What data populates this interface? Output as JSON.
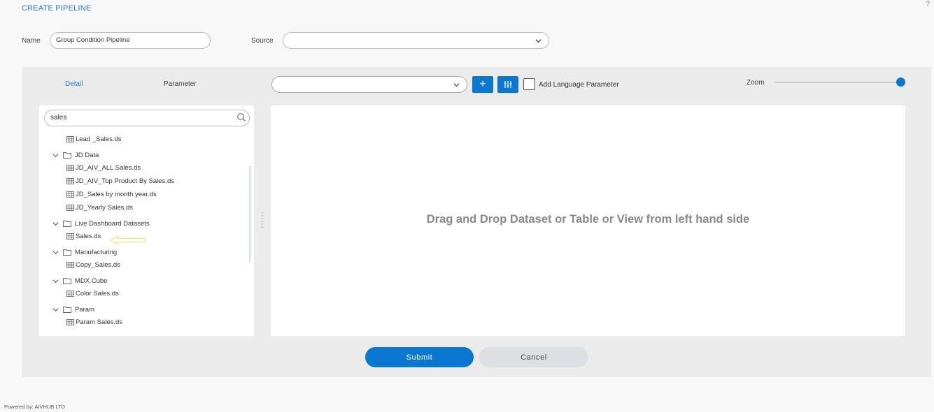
{
  "header": {
    "title": "CREATE PIPELINE",
    "help": "?"
  },
  "form": {
    "name_label": "Name",
    "name_value": "Group Condition Pipeline",
    "source_label": "Source",
    "source_value": ""
  },
  "tabs": {
    "detail": "Detail",
    "parameter": "Parameter"
  },
  "toolbar": {
    "add_label": "+",
    "lang_label": "Add Language Parameter",
    "zoom_label": "Zoom",
    "zoom_level": 1.0
  },
  "tree": {
    "search_value": "sales",
    "items": [
      {
        "type": "file",
        "label": "Lead _Sales.ds"
      },
      {
        "type": "folder",
        "label": "JD Data"
      },
      {
        "type": "file",
        "label": "JD_AIV_ALL Sales.ds"
      },
      {
        "type": "file",
        "label": "JD_AIV_Top Product By Sales.ds"
      },
      {
        "type": "file",
        "label": "JD_Sales by month year.ds"
      },
      {
        "type": "file",
        "label": "JD_Yearly Sales.ds"
      },
      {
        "type": "folder",
        "label": "Live Dashboard Datasets"
      },
      {
        "type": "file",
        "label": "Sales.ds"
      },
      {
        "type": "folder",
        "label": "Manufacturing"
      },
      {
        "type": "file",
        "label": "Copy_Sales.ds"
      },
      {
        "type": "folder",
        "label": "MDX Cube"
      },
      {
        "type": "file",
        "label": "Color Sales.ds"
      },
      {
        "type": "folder",
        "label": "Param"
      },
      {
        "type": "file",
        "label": "Param Sales.ds"
      }
    ]
  },
  "canvas": {
    "hint": "Drag and Drop Dataset or Table or View from left hand side"
  },
  "actions": {
    "submit": "Submit",
    "cancel": "Cancel"
  },
  "footer": {
    "text": "Powered by: AIVHUB LTD"
  },
  "colors": {
    "accent": "#0a78d0",
    "annotation": "#e8e85a"
  }
}
